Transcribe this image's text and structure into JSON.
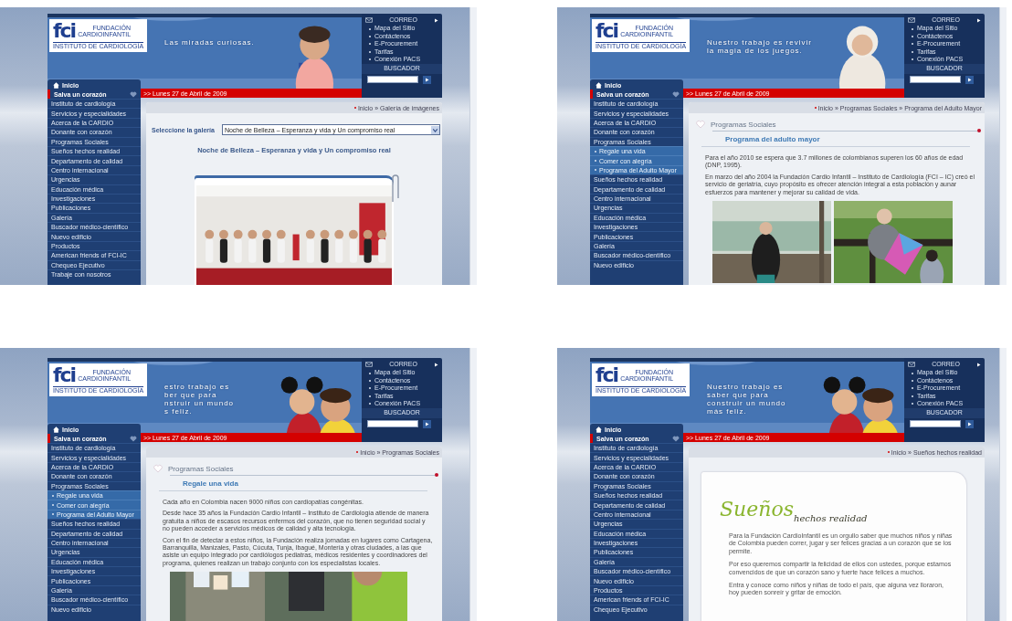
{
  "panels": [
    {
      "header": {
        "logo_mark": "fci",
        "logo_name": [
          "FUNDACIÓN",
          "CARDIOINFANTIL"
        ],
        "logo_subtitle": "INSTITUTO DE CARDIOLOGÍA",
        "mail_label": "CORREO",
        "menu": [
          "Mapa del Sitio",
          "Contáctenos",
          "E-Procurement",
          "Tarifas",
          "Conexión PACS"
        ],
        "search_label": "BUSCADOR",
        "date": ">> Lunes 27 de Abril de 2009",
        "home": "Inicio",
        "heart_item": "Salva un corazón"
      },
      "banner_text": [
        "Las miradas curiosas."
      ],
      "sidebar": [
        {
          "label": "Instituto de cardiología",
          "kind": "item"
        },
        {
          "label": "Servicios y especialidades",
          "kind": "item"
        },
        {
          "label": "Acerca de la CARDIO",
          "kind": "item"
        },
        {
          "label": "Donante con corazón",
          "kind": "item"
        },
        {
          "label": "Programas Sociales",
          "kind": "item"
        },
        {
          "label": "Sueños hechos realidad",
          "kind": "item"
        },
        {
          "label": "Departamento de calidad",
          "kind": "item"
        },
        {
          "label": "Centro internacional",
          "kind": "item"
        },
        {
          "label": "Urgencias",
          "kind": "item"
        },
        {
          "label": "Educación médica",
          "kind": "item"
        },
        {
          "label": "Investigaciones",
          "kind": "item"
        },
        {
          "label": "Publicaciones",
          "kind": "item"
        },
        {
          "label": "Galería",
          "kind": "item"
        },
        {
          "label": "Buscador médico-científico",
          "kind": "item"
        },
        {
          "label": "Nuevo edificio",
          "kind": "item"
        },
        {
          "label": "Productos",
          "kind": "item"
        },
        {
          "label": "American friends of FCI-IC",
          "kind": "item"
        },
        {
          "label": "Chequeo Ejecutivo",
          "kind": "item"
        },
        {
          "label": "Trabaje con nosotros",
          "kind": "item"
        }
      ],
      "breadcrumb": "Inicio » Galería de imágenes",
      "content": {
        "kind": "gallery",
        "label": "Seleccione la galería",
        "select_value": "Noche de Belleza – Esperanza y vida y Un compromiso real",
        "heading": "Noche de Belleza – Esperanza y vida y Un compromiso real"
      }
    },
    {
      "header": {
        "logo_mark": "fci",
        "logo_name": [
          "FUNDACIÓN",
          "CARDIOINFANTIL"
        ],
        "logo_subtitle": "INSTITUTO DE CARDIOLOGÍA",
        "mail_label": "CORREO",
        "menu": [
          "Mapa del Sitio",
          "Contáctenos",
          "E-Procurement",
          "Tarifas",
          "Conexión PACS"
        ],
        "search_label": "BUSCADOR",
        "date": ">> Lunes 27 de Abril de 2009",
        "home": "Inicio",
        "heart_item": "Salva un corazón"
      },
      "banner_text": [
        "Nuestro trabajo es revivir",
        "la magia de los juegos."
      ],
      "sidebar": [
        {
          "label": "Instituto de cardiología",
          "kind": "item"
        },
        {
          "label": "Servicios y especialidades",
          "kind": "item"
        },
        {
          "label": "Acerca de la CARDIO",
          "kind": "item"
        },
        {
          "label": "Donante con corazón",
          "kind": "item"
        },
        {
          "label": "Programas Sociales",
          "kind": "item"
        },
        {
          "label": "Regale una vida",
          "kind": "sub"
        },
        {
          "label": "Comer con alegría",
          "kind": "sub"
        },
        {
          "label": "Programa del Adulto Mayor",
          "kind": "sub"
        },
        {
          "label": "Sueños hechos realidad",
          "kind": "item"
        },
        {
          "label": "Departamento de calidad",
          "kind": "item"
        },
        {
          "label": "Centro internacional",
          "kind": "item"
        },
        {
          "label": "Urgencias",
          "kind": "item"
        },
        {
          "label": "Educación médica",
          "kind": "item"
        },
        {
          "label": "Investigaciones",
          "kind": "item"
        },
        {
          "label": "Publicaciones",
          "kind": "item"
        },
        {
          "label": "Galería",
          "kind": "item"
        },
        {
          "label": "Buscador médico-científico",
          "kind": "item"
        },
        {
          "label": "Nuevo edificio",
          "kind": "item"
        }
      ],
      "breadcrumb": "Inicio » Programas Sociales » Programa del Adulto Mayor",
      "content": {
        "kind": "article",
        "section": "Programas Sociales",
        "title": "Programa del adulto mayor",
        "paragraphs": [
          "Para el año 2010 se espera que 3.7 millones de colombianos superen los 60 años de edad (DNP, 1995).",
          "En marzo del año 2004 la Fundación Cardio Infantil – Instituto de Cardiología (FCI – IC) creó el servicio de geriatría, cuyo propósito es ofrecer atención integral a esta población y aunar esfuerzos para mantener y mejorar su calidad de vida."
        ],
        "photos": [
          {
            "kind": "picture"
          },
          {
            "kind": "picture"
          }
        ]
      }
    },
    {
      "header": {
        "logo_mark": "fci",
        "logo_name": [
          "FUNDACIÓN",
          "CARDIOINFANTIL"
        ],
        "logo_subtitle": "INSTITUTO DE CARDIOLOGÍA",
        "mail_label": "CORREO",
        "menu": [
          "Mapa del Sitio",
          "Contáctenos",
          "E-Procurement",
          "Tarifas",
          "Conexión PACS"
        ],
        "search_label": "BUSCADOR",
        "date": ">> Lunes 27 de Abril de 2009",
        "home": "Inicio",
        "heart_item": "Salva un corazón"
      },
      "banner_text": [
        "estro trabajo es",
        "ber que para",
        "nstruir un mundo",
        "s feliz."
      ],
      "sidebar": [
        {
          "label": "Instituto de cardiología",
          "kind": "item"
        },
        {
          "label": "Servicios y especialidades",
          "kind": "item"
        },
        {
          "label": "Acerca de la CARDIO",
          "kind": "item"
        },
        {
          "label": "Donante con corazón",
          "kind": "item"
        },
        {
          "label": "Programas Sociales",
          "kind": "item"
        },
        {
          "label": "Regale una vida",
          "kind": "sub"
        },
        {
          "label": "Comer con alegría",
          "kind": "sub"
        },
        {
          "label": "Programa del Adulto Mayor",
          "kind": "sub"
        },
        {
          "label": "Sueños hechos realidad",
          "kind": "item"
        },
        {
          "label": "Departamento de calidad",
          "kind": "item"
        },
        {
          "label": "Centro internacional",
          "kind": "item"
        },
        {
          "label": "Urgencias",
          "kind": "item"
        },
        {
          "label": "Educación médica",
          "kind": "item"
        },
        {
          "label": "Investigaciones",
          "kind": "item"
        },
        {
          "label": "Publicaciones",
          "kind": "item"
        },
        {
          "label": "Galería",
          "kind": "item"
        },
        {
          "label": "Buscador médico-científico",
          "kind": "item"
        },
        {
          "label": "Nuevo edificio",
          "kind": "item"
        }
      ],
      "breadcrumb": "Inicio » Programas Sociales",
      "content": {
        "kind": "article",
        "section": "Programas Sociales",
        "title": "Regale una vida",
        "paragraphs": [
          "Cada año en Colombia nacen 9000 niños con cardiopatías congénitas.",
          "Desde hace 35 años la Fundación Cardio Infantil – Instituto de Cardiología atiende de manera gratuita a niños de escasos recursos enfermos del corazón, que no tienen seguridad social y no pueden acceder a servicios médicos de calidad y alta tecnología.",
          "Con el fin de detectar a estos niños, la Fundación realiza jornadas en lugares como Cartagena, Barranquilla, Manizales, Pasto, Cúcuta, Tunja, Ibagué, Montería y otras ciudades, a las que asiste un equipo integrado por cardiólogos pediatras, médicos residentes y coordinadores del programa, quienes realizan un trabajo conjunto con los especialistas locales."
        ],
        "photos": [
          {
            "kind": "picture"
          }
        ]
      }
    },
    {
      "header": {
        "logo_mark": "fci",
        "logo_name": [
          "FUNDACIÓN",
          "CARDIOINFANTIL"
        ],
        "logo_subtitle": "INSTITUTO DE CARDIOLOGÍA",
        "mail_label": "CORREO",
        "menu": [
          "Mapa del Sitio",
          "Contáctenos",
          "E-Procurement",
          "Tarifas",
          "Conexión PACS"
        ],
        "search_label": "BUSCADOR",
        "date": ">> Lunes 27 de Abril de 2009",
        "home": "Inicio",
        "heart_item": "Salva un corazón"
      },
      "banner_text": [
        "Nuestro trabajo es",
        "saber que para",
        "construir un mundo",
        "más feliz."
      ],
      "sidebar": [
        {
          "label": "Instituto de cardiología",
          "kind": "item"
        },
        {
          "label": "Servicios y especialidades",
          "kind": "item"
        },
        {
          "label": "Acerca de la CARDIO",
          "kind": "item"
        },
        {
          "label": "Donante con corazón",
          "kind": "item"
        },
        {
          "label": "Programas Sociales",
          "kind": "item"
        },
        {
          "label": "Sueños hechos realidad",
          "kind": "item"
        },
        {
          "label": "Departamento de calidad",
          "kind": "item"
        },
        {
          "label": "Centro internacional",
          "kind": "item"
        },
        {
          "label": "Urgencias",
          "kind": "item"
        },
        {
          "label": "Educación médica",
          "kind": "item"
        },
        {
          "label": "Investigaciones",
          "kind": "item"
        },
        {
          "label": "Publicaciones",
          "kind": "item"
        },
        {
          "label": "Galería",
          "kind": "item"
        },
        {
          "label": "Buscador médico-científico",
          "kind": "item"
        },
        {
          "label": "Nuevo edificio",
          "kind": "item"
        },
        {
          "label": "Productos",
          "kind": "item"
        },
        {
          "label": "American friends of FCI-IC",
          "kind": "item"
        },
        {
          "label": "Chequeo Ejecutivo",
          "kind": "item"
        }
      ],
      "breadcrumb": "Inicio » Sueños hechos realidad",
      "content": {
        "kind": "dreams",
        "title": "Sueños",
        "subtitle": "hechos realidad",
        "paragraphs": [
          "Para la Fundación CardioInfantil es un orgullo saber que muchos niños y niñas de Colombia pueden correr, jugar y ser felices gracias a un corazón que se los permite.",
          "Por eso queremos compartir la felicidad de ellos con ustedes, porque estamos convencidos de que un corazón sano y fuerte hace felices a muchos.",
          "Entra y conoce como niños y niñas de todo el país, que alguna vez lloraron, hoy pueden sonreír y gritar de emoción."
        ]
      }
    }
  ]
}
